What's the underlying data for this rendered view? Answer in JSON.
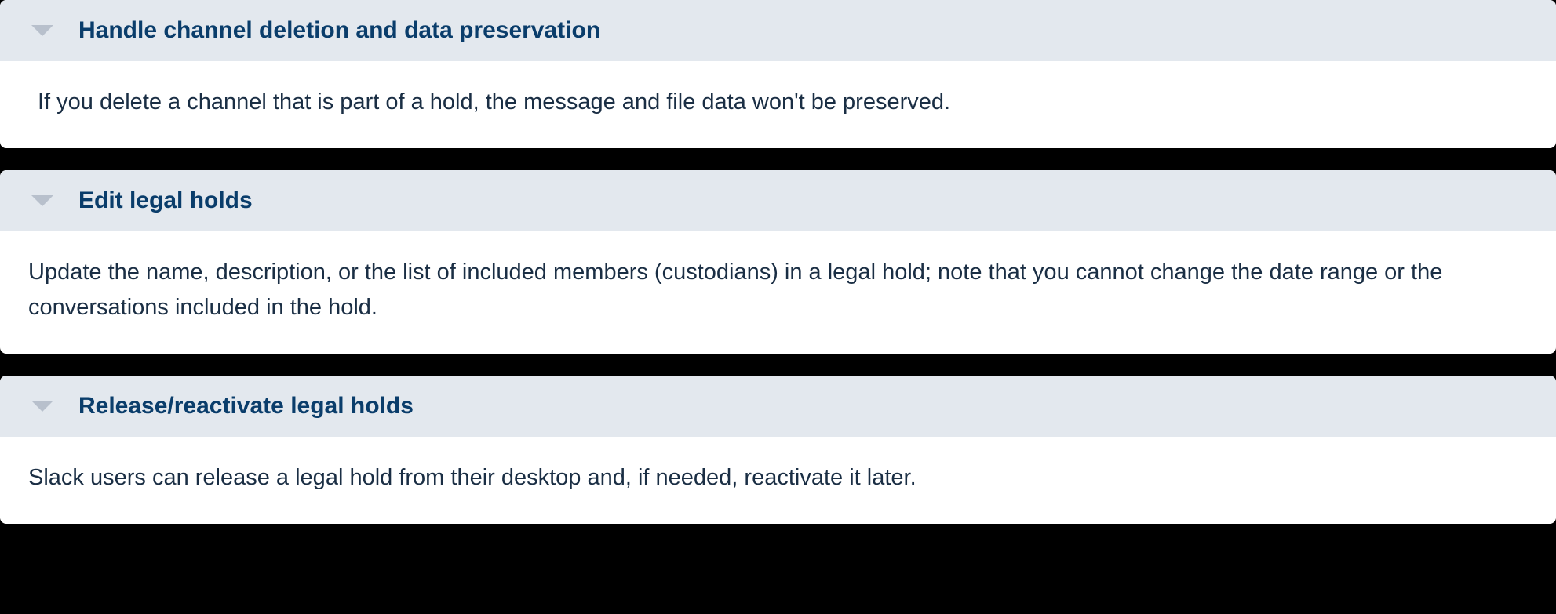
{
  "accordion": {
    "items": [
      {
        "title": "Handle channel deletion and data preservation",
        "body": "If you delete a channel that is part of a hold, the message and file data won't be preserved."
      },
      {
        "title": "Edit legal holds",
        "body": "Update the name, description, or the list of included members (custodians) in a legal hold; note that you cannot change the date range or the conversations included in the hold."
      },
      {
        "title": "Release/reactivate legal holds",
        "body": "Slack users can release a legal hold from their desktop and, if needed, reactivate it later."
      }
    ]
  }
}
